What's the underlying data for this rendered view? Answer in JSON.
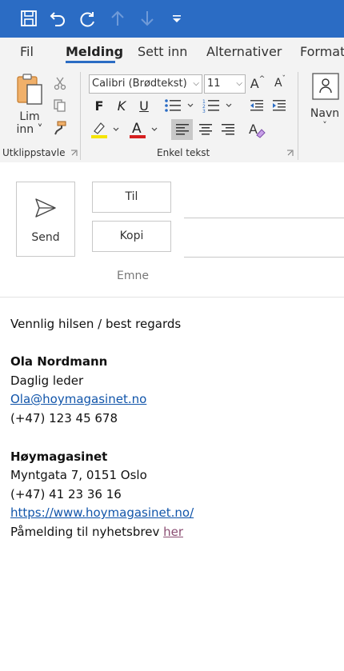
{
  "ribbon_tabs": [
    {
      "label": "Fil"
    },
    {
      "label": "Melding"
    },
    {
      "label": "Sett inn"
    },
    {
      "label": "Alternativer"
    },
    {
      "label": "Formate"
    }
  ],
  "clipboard": {
    "paste_label_1": "Lim",
    "paste_label_2": "inn",
    "group_label": "Utklippstavle"
  },
  "basic_text": {
    "font_name": "Calibri (Brødtekst)",
    "font_size": "11",
    "bold_label": "F",
    "italic_label": "K",
    "underline_label": "U",
    "font_color_letter": "A",
    "grow_label": "A",
    "shrink_label": "A",
    "group_label": "Enkel tekst",
    "highlight_color": "#f5e400",
    "font_color": "#d62020"
  },
  "names": {
    "label": "Navn"
  },
  "compose": {
    "send_label": "Send",
    "to_label": "Til",
    "cc_label": "Kopi",
    "subject_label": "Emne"
  },
  "signature": {
    "closing": "Vennlig hilsen / best regards",
    "name": "Ola Nordmann",
    "title": "Daglig leder",
    "email": "Ola@hoymagasinet.no",
    "phone": "(+47) 123 45 678",
    "company": "Høymagasinet",
    "address": "Myntgata 7, 0151 Oslo",
    "company_phone": "(+47) 41 23 36 16",
    "website": "https://www.hoymagasinet.no/",
    "newsletter_text": "Påmelding til nyhetsbrev ",
    "newsletter_link": "her"
  },
  "colors": {
    "accent": "#2b6cc4",
    "link": "#1155aa",
    "visited_link": "#8a4d72"
  }
}
